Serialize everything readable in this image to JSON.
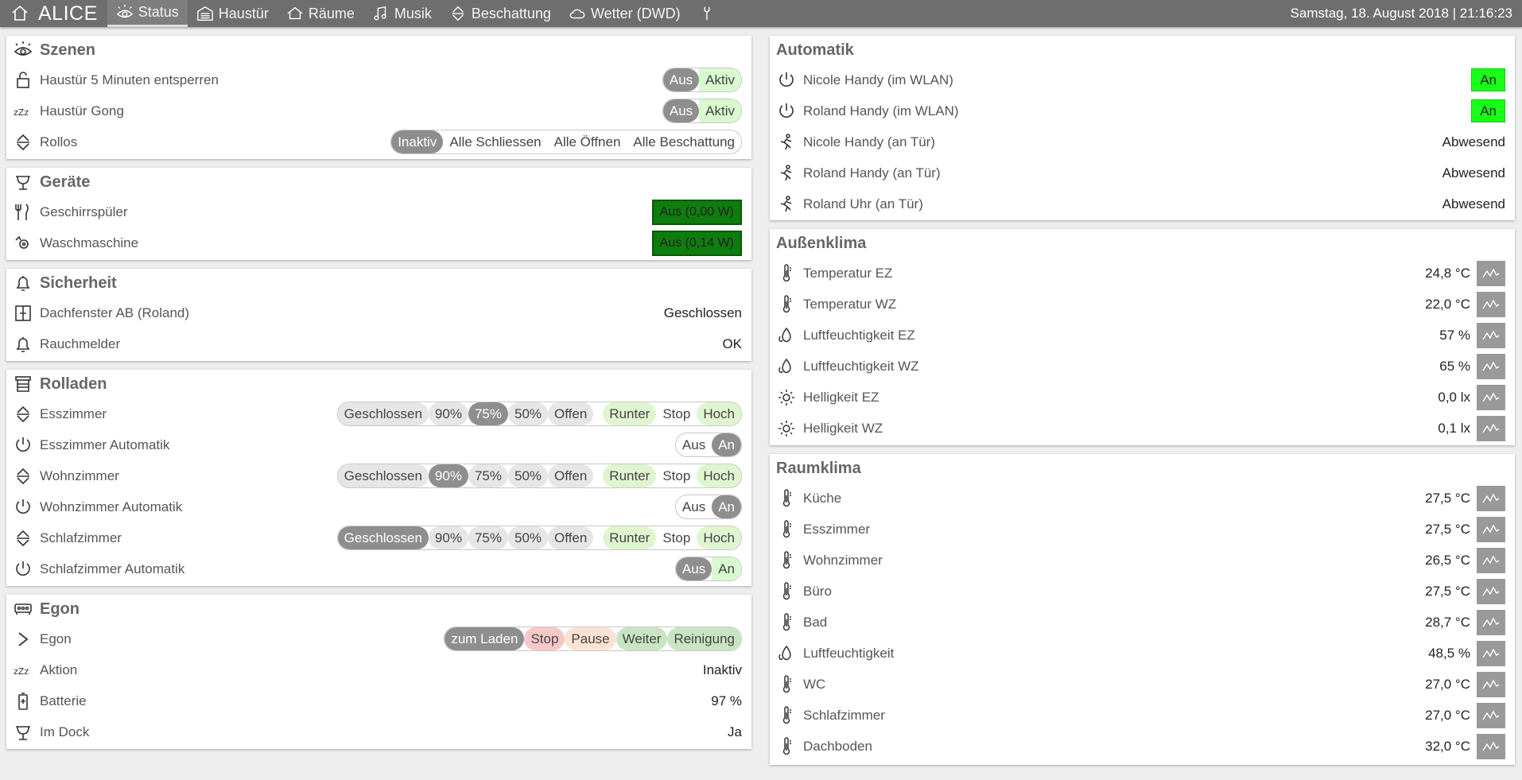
{
  "app": {
    "brand": "ALICE",
    "clock": "Samstag, 18. August 2018 | 21:16:23",
    "nav": [
      {
        "label": "Status",
        "icon": "eye-icon",
        "active": true
      },
      {
        "label": "Haustür",
        "icon": "garage-icon"
      },
      {
        "label": "Räume",
        "icon": "house-icon"
      },
      {
        "label": "Musik",
        "icon": "music-icon"
      },
      {
        "label": "Beschattung",
        "icon": "updown-icon"
      },
      {
        "label": "Wetter (DWD)",
        "icon": "cloud-icon"
      },
      {
        "label": "",
        "icon": "wrench-icon"
      }
    ]
  },
  "szenen": {
    "title": "Szenen",
    "rows": [
      {
        "label": "Haustür 5 Minuten entsperren",
        "opts": [
          "Aus",
          "Aktiv"
        ]
      },
      {
        "label": "Haustür Gong",
        "opts": [
          "Aus",
          "Aktiv"
        ]
      },
      {
        "label": "Rollos",
        "opts": [
          "Inaktiv",
          "Alle Schliessen",
          "Alle Öffnen",
          "Alle Beschattung"
        ]
      }
    ]
  },
  "geraete": {
    "title": "Geräte",
    "rows": [
      {
        "label": "Geschirrspüler",
        "value": "Aus (0,00 W)"
      },
      {
        "label": "Waschmaschine",
        "value": "Aus (0,14 W)"
      }
    ]
  },
  "sicherheit": {
    "title": "Sicherheit",
    "rows": [
      {
        "label": "Dachfenster AB (Roland)",
        "value": "Geschlossen"
      },
      {
        "label": "Rauchmelder",
        "value": "OK"
      }
    ]
  },
  "rolladen": {
    "title": "Rolladen",
    "pos_opts": [
      "Geschlossen",
      "90%",
      "75%",
      "50%",
      "Offen"
    ],
    "move_opts": [
      "Runter",
      "Stop",
      "Hoch"
    ],
    "auto_opts": [
      "Aus",
      "An"
    ],
    "rows": [
      {
        "label": "Esszimmer",
        "selected": "75%"
      },
      {
        "label": "Esszimmer Automatik"
      },
      {
        "label": "Wohnzimmer",
        "selected": "90%"
      },
      {
        "label": "Wohnzimmer Automatik"
      },
      {
        "label": "Schlafzimmer",
        "selected": "Geschlossen"
      },
      {
        "label": "Schlafzimmer Automatik"
      }
    ]
  },
  "egon": {
    "title": "Egon",
    "opts": [
      "zum Laden",
      "Stop",
      "Pause",
      "Weiter",
      "Reinigung"
    ],
    "rows": [
      {
        "label": "Egon"
      },
      {
        "label": "Aktion",
        "value": "Inaktiv"
      },
      {
        "label": "Batterie",
        "value": "97 %"
      },
      {
        "label": "Im Dock",
        "value": "Ja"
      }
    ]
  },
  "automatik": {
    "title": "Automatik",
    "rows": [
      {
        "label": "Nicole Handy (im WLAN)",
        "value": "An"
      },
      {
        "label": "Roland Handy (im WLAN)",
        "value": "An"
      },
      {
        "label": "Nicole Handy (an Tür)",
        "value": "Abwesend"
      },
      {
        "label": "Roland Handy (an Tür)",
        "value": "Abwesend"
      },
      {
        "label": "Roland Uhr (an Tür)",
        "value": "Abwesend"
      }
    ]
  },
  "aussenklima": {
    "title": "Außenklima",
    "rows": [
      {
        "label": "Temperatur EZ",
        "value": "24,8 °C",
        "icon": "thermometer-icon"
      },
      {
        "label": "Temperatur WZ",
        "value": "22,0 °C",
        "icon": "thermometer-icon"
      },
      {
        "label": "Luftfeuchtigkeit EZ",
        "value": "57 %",
        "icon": "droplet-icon"
      },
      {
        "label": "Luftfeuchtigkeit WZ",
        "value": "65 %",
        "icon": "droplet-icon"
      },
      {
        "label": "Helligkeit EZ",
        "value": "0,0 lx",
        "icon": "sun-icon"
      },
      {
        "label": "Helligkeit WZ",
        "value": "0,1 lx",
        "icon": "sun-icon"
      }
    ]
  },
  "raumklima": {
    "title": "Raumklima",
    "rows": [
      {
        "label": "Küche",
        "value": "27,5 °C",
        "icon": "thermometer-icon"
      },
      {
        "label": "Esszimmer",
        "value": "27,5 °C",
        "icon": "thermometer-icon"
      },
      {
        "label": "Wohnzimmer",
        "value": "26,5 °C",
        "icon": "thermometer-icon"
      },
      {
        "label": "Büro",
        "value": "27,5 °C",
        "icon": "thermometer-icon"
      },
      {
        "label": "Bad",
        "value": "28,7 °C",
        "icon": "thermometer-icon"
      },
      {
        "label": "Luftfeuchtigkeit",
        "value": "48,5 %",
        "icon": "droplet-icon"
      },
      {
        "label": "WC",
        "value": "27,0 °C",
        "icon": "thermometer-icon"
      },
      {
        "label": "Schlafzimmer",
        "value": "27,0 °C",
        "icon": "thermometer-icon"
      },
      {
        "label": "Dachboden",
        "value": "32,0 °C",
        "icon": "thermometer-icon"
      }
    ]
  },
  "colors": {
    "nav": "#6e6e6e",
    "on": "#8e8e8e",
    "green_box": "#0e7d0e",
    "lime_box": "#16ff16"
  }
}
